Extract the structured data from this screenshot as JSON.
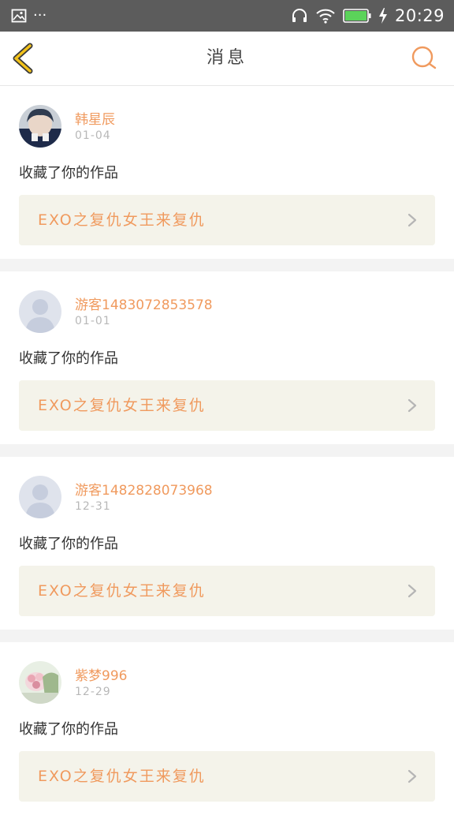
{
  "status_bar": {
    "time": "20:29",
    "left_icons": [
      "image-icon",
      "more-dots-icon"
    ],
    "more_dots": "···",
    "right_icons": [
      "headphones-icon",
      "wifi-icon",
      "battery-icon",
      "charging-icon"
    ],
    "battery_color": "#5bd35a"
  },
  "header": {
    "title": "消息",
    "back_icon": "chevron-left-icon",
    "search_icon": "search-icon",
    "accent_color": "#f09a5e",
    "back_color": "#f2c21b"
  },
  "messages": [
    {
      "user": "韩星辰",
      "date": "01-04",
      "action": "收藏了你的作品",
      "work_title": "EXO之复仇女王来复仇",
      "avatar": "photo"
    },
    {
      "user": "游客1483072853578",
      "date": "01-01",
      "action": "收藏了你的作品",
      "work_title": "EXO之复仇女王来复仇",
      "avatar": "default"
    },
    {
      "user": "游客1482828073968",
      "date": "12-31",
      "action": "收藏了你的作品",
      "work_title": "EXO之复仇女王来复仇",
      "avatar": "default"
    },
    {
      "user": "紫梦996",
      "date": "12-29",
      "action": "收藏了你的作品",
      "work_title": "EXO之复仇女王来复仇",
      "avatar": "flowers"
    }
  ]
}
